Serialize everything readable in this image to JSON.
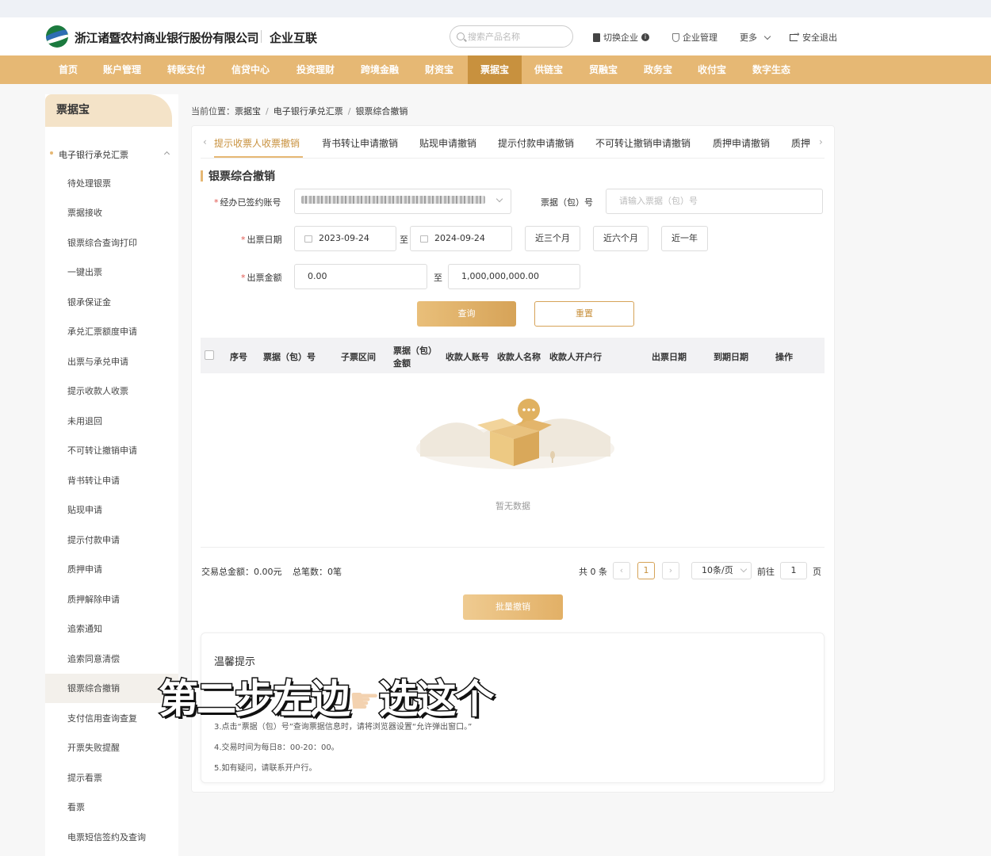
{
  "header": {
    "bank_name": "浙江诸暨农村商业银行股份有限公司",
    "product_name": "企业互联",
    "search_placeholder": "搜索产品名称",
    "switch_company": "切换企业",
    "company_manage": "企业管理",
    "more": "更多",
    "logout": "安全退出"
  },
  "nav": {
    "items": [
      "首页",
      "账户管理",
      "转账支付",
      "信贷中心",
      "投资理财",
      "跨境金融",
      "财资宝",
      "票据宝",
      "供链宝",
      "贸融宝",
      "政务宝",
      "收付宝",
      "数字生态"
    ],
    "active": "票据宝"
  },
  "sidebar": {
    "title": "票据宝",
    "group": "电子银行承兑汇票",
    "items": [
      "待处理银票",
      "票据接收",
      "银票综合查询打印",
      "一键出票",
      "银承保证金",
      "承兑汇票额度申请",
      "出票与承兑申请",
      "提示收款人收票",
      "未用退回",
      "不可转让撤销申请",
      "背书转让申请",
      "贴现申请",
      "提示付款申请",
      "质押申请",
      "质押解除申请",
      "追索通知",
      "追索同意清偿",
      "银票综合撤销",
      "支付信用查询查复",
      "开票失败提醒",
      "提示看票",
      "看票",
      "电票短信签约及查询"
    ],
    "active": "银票综合撤销"
  },
  "breadcrumb": {
    "prefix": "当前位置：",
    "items": [
      "票据宝",
      "电子银行承兑汇票",
      "银票综合撤销"
    ]
  },
  "tabs": {
    "items": [
      "提示收票人收票撤销",
      "背书转让申请撤销",
      "贴现申请撤销",
      "提示付款申请撤销",
      "不可转让撤销申请撤销",
      "质押申请撤销",
      "质押"
    ],
    "active": "提示收票人收票撤销"
  },
  "form": {
    "section_title": "银票综合撤销",
    "account_label": "经办已签约账号",
    "bill_no_label": "票据（包）号",
    "bill_no_placeholder": "请输入票据（包）号",
    "date_label": "出票日期",
    "date_from": "2023-09-24",
    "date_to": "2024-09-24",
    "to": "至",
    "quick": [
      "近三个月",
      "近六个月",
      "近一年"
    ],
    "amount_label": "出票金额",
    "amount_from": "0.00",
    "amount_to": "1,000,000,000.00",
    "query": "查询",
    "reset": "重置"
  },
  "table": {
    "columns": [
      "序号",
      "票据（包）号",
      "子票区间",
      "票据（包）",
      "金额",
      "收款人账号",
      "收款人名称",
      "收款人开户行",
      "出票日期",
      "到期日期",
      "操作"
    ],
    "empty": "暂无数据"
  },
  "summary": {
    "total_amount": "交易总金额：0.00元",
    "total_count": "总笔数：0笔"
  },
  "pager": {
    "total": "共 0 条",
    "page": "1",
    "page_size": "10条/页",
    "goto_label": "前往",
    "goto_value": "1",
    "page_suffix": "页"
  },
  "batch_button": "批量撤销",
  "tips": {
    "title": "温馨提示",
    "lines": [
      "3.点击“票据（包）号”查询票据信息时，请将浏览器设置“允许弹出窗口。”",
      "4.交易时间为每日8：00-20：00。",
      "5.如有疑问，请联系开户行。"
    ]
  },
  "overlay": {
    "left": "第二步左边",
    "right": "选这个"
  },
  "colors": {
    "accent": "#e6b874",
    "accent_dark": "#c8913e"
  }
}
